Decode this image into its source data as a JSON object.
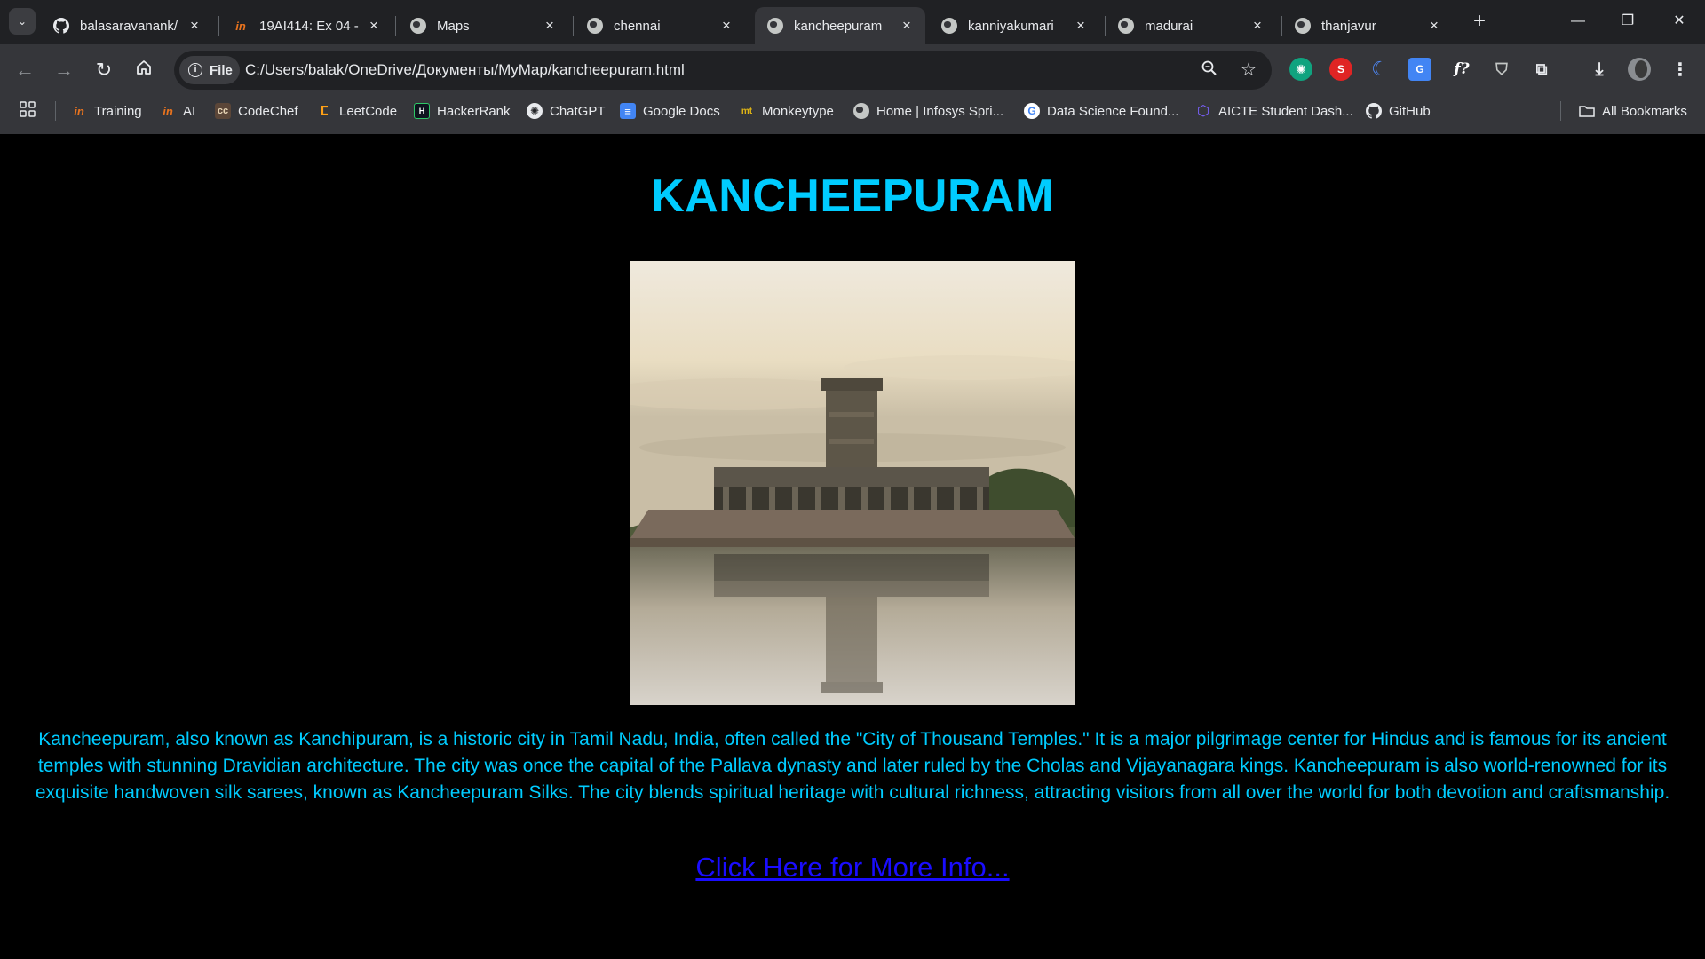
{
  "tabs": [
    {
      "title": "balasaravanank/",
      "favicon": "github-icon"
    },
    {
      "title": "19AI414: Ex 04 -",
      "favicon": "infosys-icon"
    },
    {
      "title": "Maps",
      "favicon": "globe-icon"
    },
    {
      "title": "chennai",
      "favicon": "globe-icon"
    },
    {
      "title": "kancheepuram",
      "favicon": "globe-icon",
      "active": true
    },
    {
      "title": "kanniyakumari",
      "favicon": "globe-icon"
    },
    {
      "title": "madurai",
      "favicon": "globe-icon"
    },
    {
      "title": "thanjavur",
      "favicon": "globe-icon"
    }
  ],
  "omnibox": {
    "scheme_chip": "File",
    "url": "C:/Users/balak/OneDrive/Документы/MyMap/kancheepuram.html"
  },
  "bookmarks": [
    {
      "label": "Training",
      "icon": "infosys-icon"
    },
    {
      "label": "AI",
      "icon": "infosys-icon"
    },
    {
      "label": "CodeChef",
      "icon": "codechef-icon"
    },
    {
      "label": "LeetCode",
      "icon": "leetcode-icon"
    },
    {
      "label": "HackerRank",
      "icon": "hackerrank-icon"
    },
    {
      "label": "ChatGPT",
      "icon": "chatgpt-icon"
    },
    {
      "label": "Google Docs",
      "icon": "google-docs-icon"
    },
    {
      "label": "Monkeytype",
      "icon": "monkeytype-icon"
    },
    {
      "label": "Home | Infosys Spri...",
      "icon": "globe-icon"
    },
    {
      "label": "Data Science Found...",
      "icon": "google-icon"
    },
    {
      "label": "AICTE Student Dash...",
      "icon": "aicte-icon"
    },
    {
      "label": "GitHub",
      "icon": "github-icon"
    }
  ],
  "all_bookmarks": "All Bookmarks",
  "page": {
    "title": "KANCHEEPURAM",
    "description": "Kancheepuram, also known as Kanchipuram, is a historic city in Tamil Nadu, India, often called the \"City of Thousand Temples.\" It is a major pilgrimage center for Hindus and is famous for its ancient temples with stunning Dravidian architecture. The city was once the capital of the Pallava dynasty and later ruled by the Cholas and Vijayanagara kings. Kancheepuram is also world-renowned for its exquisite handwoven silk sarees, known as Kancheepuram Silks. The city blends spiritual heritage with cultural richness, attracting visitors from all over the world for both devotion and craftsmanship.",
    "link_text": "Click Here for More Info..."
  },
  "colors": {
    "accent": "#00ccff",
    "link": "#1a0dff",
    "background": "#000000"
  }
}
